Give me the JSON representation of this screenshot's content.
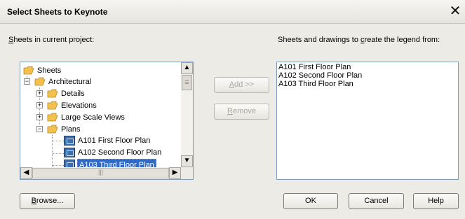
{
  "window": {
    "title": "Select Sheets to Keynote",
    "close_glyph": "✕"
  },
  "left_label": {
    "prefix": "S",
    "rest": "heets in current project:"
  },
  "right_label": {
    "before": "Sheets and drawings to ",
    "mnemonic": "c",
    "after": "reate the legend from:"
  },
  "tree": {
    "root": "Sheets",
    "architectural": "Architectural",
    "details": "Details",
    "elevations": "Elevations",
    "large_scale_views": "Large Scale Views",
    "plans": "Plans",
    "sheets": [
      "A101 First Floor Plan",
      "A102 Second Floor Plan",
      "A103 Third Floor Plan"
    ],
    "expand_glyph": "+",
    "collapse_glyph": "−"
  },
  "buttons": {
    "add": {
      "mnemonic": "A",
      "rest": "dd >>"
    },
    "remove": {
      "mnemonic": "R",
      "rest": "emove"
    },
    "browse": {
      "mnemonic": "B",
      "rest": "rowse..."
    },
    "ok": "OK",
    "cancel": "Cancel",
    "help": "Help"
  },
  "scroll": {
    "up": "▲",
    "down": "▼",
    "left": "◀",
    "right": "▶",
    "grip": "≡",
    "hgrip": "|||"
  },
  "right_list": [
    "A101 First Floor Plan",
    "A102 Second Floor Plan",
    "A103 Third Floor Plan"
  ],
  "colors": {
    "selection": "#316ac5",
    "folder": "#f2c14e",
    "sheet_icon": "#3a6fb2"
  }
}
